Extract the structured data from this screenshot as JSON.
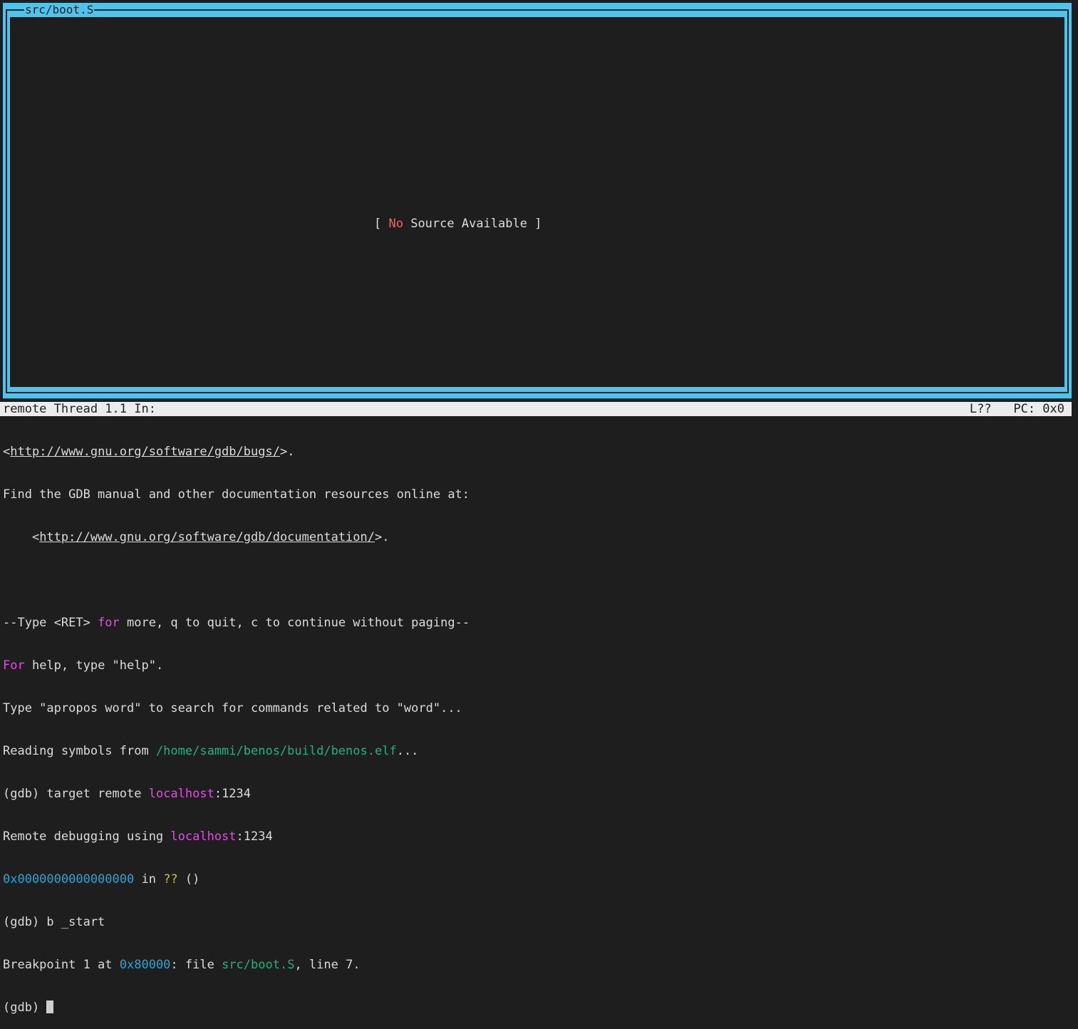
{
  "source_window": {
    "title": "src/boot.S",
    "placeholder_open": "[ ",
    "placeholder_no": "No",
    "placeholder_rest": " Source Available ]"
  },
  "status_bar": {
    "left": "remote Thread 1.1 In:",
    "line": "L??",
    "pc": "PC: 0x0"
  },
  "console": {
    "l1_a": "<",
    "l1_link": "http://www.gnu.org/software/gdb/bugs/",
    "l1_b": ">.",
    "l2": "Find the GDB manual and other documentation resources online at:",
    "l3_a": "    <",
    "l3_link": "http://www.gnu.org/software/gdb/documentation/",
    "l3_b": ">.",
    "l5_a": "--Type <RET> ",
    "l5_for": "for",
    "l5_b": " more, q to quit, c to continue without paging--",
    "l6_for": "For",
    "l6_b": " help, type \"help\".",
    "l7": "Type \"apropos word\" to search for commands related to \"word\"...",
    "l8_a": "Reading symbols from ",
    "l8_path": "/home/sammi/benos/build/benos.elf",
    "l8_b": "...",
    "l9_a": "(gdb) target remote ",
    "l9_host": "localhost",
    "l9_b": ":1234",
    "l10_a": "Remote debugging using ",
    "l10_host": "localhost",
    "l10_b": ":1234",
    "l11_addr": "0x0000000000000000",
    "l11_in": " in ",
    "l11_q": "??",
    "l11_b": " ()",
    "l12": "(gdb) b _start",
    "l13_a": "Breakpoint 1 at ",
    "l13_addr": "0x80000",
    "l13_b": ": file ",
    "l13_file": "src/boot.S",
    "l13_c": ", line 7.",
    "l14_prompt": "(gdb) "
  }
}
